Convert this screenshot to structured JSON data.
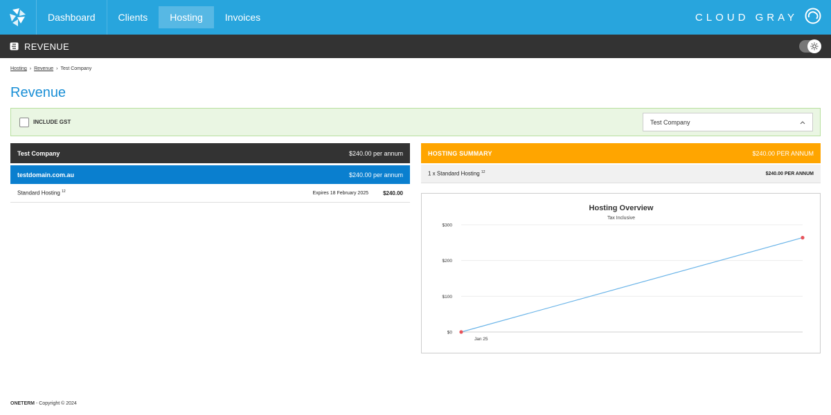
{
  "nav": {
    "items": [
      {
        "label": "Dashboard",
        "active": false
      },
      {
        "label": "Clients",
        "active": false
      },
      {
        "label": "Hosting",
        "active": true
      },
      {
        "label": "Invoices",
        "active": false
      }
    ],
    "brand": "CLOUD GRAY",
    "logo_icon": "logo-icon"
  },
  "subbar": {
    "title": "REVENUE",
    "icon": "revenue-icon"
  },
  "breadcrumb": {
    "items": [
      "Hosting",
      "Revenue",
      "Test Company"
    ]
  },
  "page": {
    "title": "Revenue"
  },
  "filter": {
    "gst_label": "INCLUDE GST",
    "gst_checked": false,
    "company": "Test Company"
  },
  "left": {
    "client": {
      "name": "Test Company",
      "amount": "$240.00 per annum"
    },
    "domain": {
      "name": "testdomain.com.au",
      "amount": "$240.00 per annum"
    },
    "item": {
      "name": "Standard Hosting",
      "sup": "12",
      "expires": "Expires 18 February 2025",
      "amount": "$240.00"
    }
  },
  "summary": {
    "title": "HOSTING SUMMARY",
    "amount": "$240.00 PER ANNUM",
    "row": {
      "label": "1 x Standard Hosting",
      "sup": "12",
      "amount": "$240.00 PER ANNUM"
    }
  },
  "chart_data": {
    "type": "line",
    "title": "Hosting Overview",
    "subtitle": "Tax Inclusive",
    "xlabel": "",
    "ylabel": "",
    "ylim": [
      0,
      300
    ],
    "yticks": [
      "$0",
      "$100",
      "$200",
      "$300"
    ],
    "x_tick_labels": [
      "Jan 25"
    ],
    "series": [
      {
        "values": [
          0,
          264
        ],
        "color": "#6ab4e8",
        "point_color": "#e8545b"
      }
    ],
    "grid": true
  },
  "footer": {
    "brand": "ONETERM",
    "copyright": " - Copyright © 2024"
  }
}
